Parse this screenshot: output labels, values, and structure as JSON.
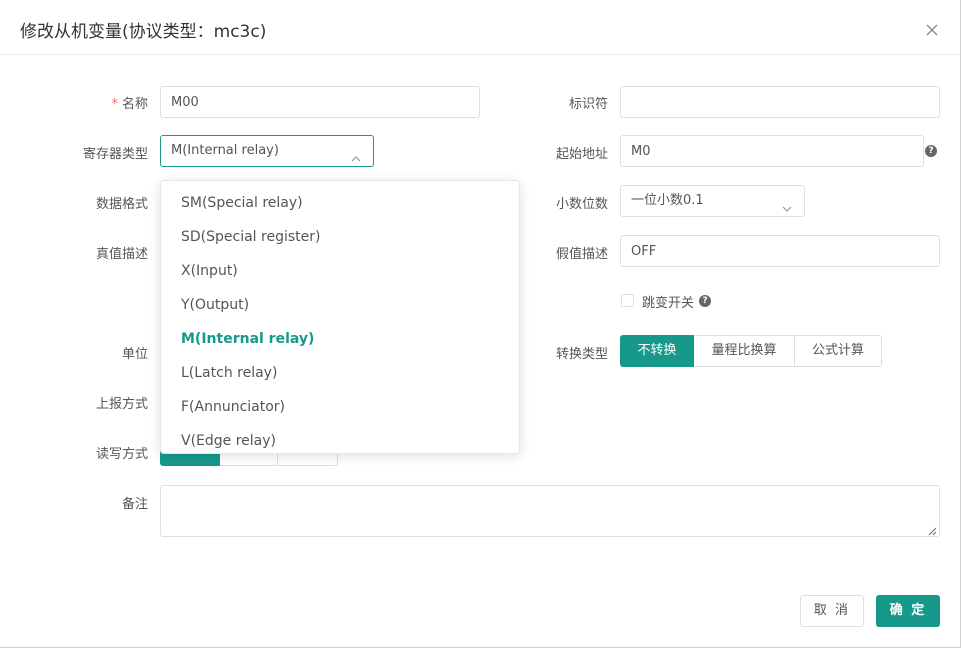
{
  "dialog": {
    "title": "修改从机变量(协议类型：mc3c)"
  },
  "form": {
    "name": {
      "label": "名称",
      "value": "M00"
    },
    "identifier": {
      "label": "标识符",
      "value": ""
    },
    "register_type": {
      "label": "寄存器类型",
      "value": "M(Internal relay)"
    },
    "start_address": {
      "label": "起始地址",
      "value": "M0"
    },
    "data_format": {
      "label": "数据格式"
    },
    "decimal_places": {
      "label": "小数位数",
      "value": "一位小数0.1"
    },
    "true_desc": {
      "label": "真值描述"
    },
    "false_desc": {
      "label": "假值描述",
      "value": "OFF"
    },
    "toggle_switch": {
      "label": "跳变开关"
    },
    "unit": {
      "label": "单位"
    },
    "conversion_type": {
      "label": "转换类型",
      "options": [
        "不转换",
        "量程比换算",
        "公式计算"
      ],
      "selected": "不转换"
    },
    "report_mode": {
      "label": "上报方式"
    },
    "rw_mode": {
      "label": "读写方式"
    },
    "remark": {
      "label": "备注",
      "value": ""
    }
  },
  "dropdown": {
    "options": [
      "SM(Special relay)",
      "SD(Special register)",
      "X(Input)",
      "Y(Output)",
      "M(Internal relay)",
      "L(Latch relay)",
      "F(Annunciator)",
      "V(Edge relay)"
    ],
    "selected": "M(Internal relay)"
  },
  "footer": {
    "cancel": "取 消",
    "ok": "确 定"
  },
  "colors": {
    "accent": "#16998a",
    "required": "#f56c6c"
  }
}
